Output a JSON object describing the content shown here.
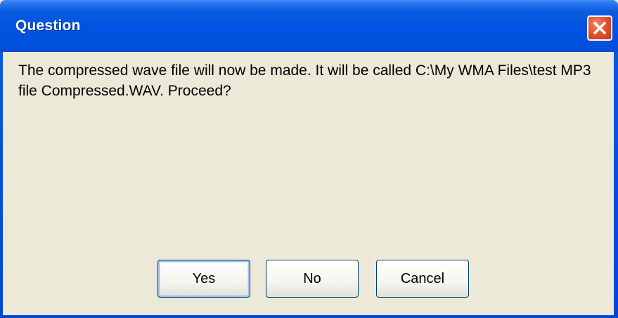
{
  "window": {
    "title": "Question",
    "message": "The compressed wave file will now be made. It will be called C:\\My WMA Files\\test MP3 file Compressed.WAV. Proceed?"
  },
  "buttons": {
    "yes": "Yes",
    "no": "No",
    "cancel": "Cancel"
  },
  "icons": {
    "close": "close-icon"
  },
  "colors": {
    "titlebar": "#0053e1",
    "close_button": "#e2542e",
    "dialog_background": "#ece9d8"
  }
}
